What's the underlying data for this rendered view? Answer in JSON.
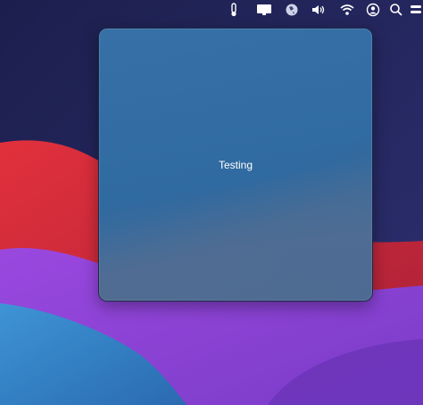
{
  "menubar": {
    "icons": [
      "thermometer-icon",
      "display-icon",
      "globe-icon",
      "volume-icon",
      "wifi-icon",
      "user-icon",
      "search-icon",
      "control-center-icon"
    ]
  },
  "popover": {
    "text": "Testing"
  },
  "colors": {
    "popover_top": "#3770a6",
    "popover_bottom": "#4f6b90",
    "wallpaper_navy": "#2a2d66",
    "wallpaper_red": "#c8283a",
    "wallpaper_purple": "#8c3fd0",
    "wallpaper_blue": "#3a7ec0"
  }
}
